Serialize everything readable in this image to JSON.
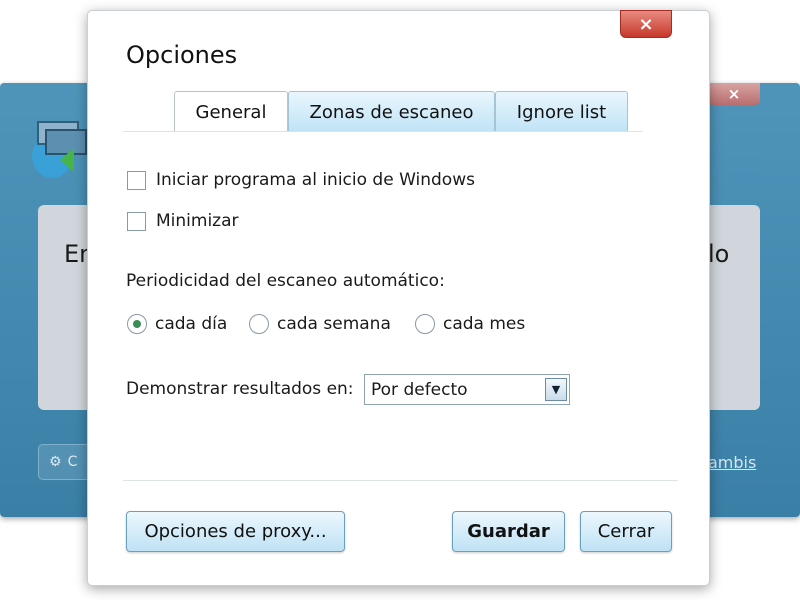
{
  "background_window": {
    "close_glyph": "×",
    "text_left": "En",
    "text_right": "lo",
    "settings_glyph": "⚙",
    "settings_text": "C",
    "link_text": "ambis"
  },
  "dialog": {
    "title": "Opciones",
    "close_glyph": "×",
    "tabs": [
      {
        "label": "General",
        "active": true
      },
      {
        "label": "Zonas de escaneo",
        "active": false
      },
      {
        "label": "Ignore list",
        "active": false
      }
    ],
    "checkboxes": [
      {
        "label": "Iniciar programa al inicio de Windows",
        "checked": false
      },
      {
        "label": "Minimizar",
        "checked": false
      }
    ],
    "period_label": "Periodicidad del escaneo automático:",
    "radios": [
      {
        "label": "cada día",
        "selected": true
      },
      {
        "label": "cada semana",
        "selected": false
      },
      {
        "label": "cada mes",
        "selected": false
      }
    ],
    "results_label": "Demonstrar resultados en:",
    "results_value": "Por defecto",
    "buttons": {
      "proxy": "Opciones de proxy...",
      "save": "Guardar",
      "close": "Cerrar"
    }
  },
  "colors": {
    "accent_blue": "#bfe2f5",
    "close_red": "#c7382c",
    "radio_selected": "#3a8d56"
  }
}
